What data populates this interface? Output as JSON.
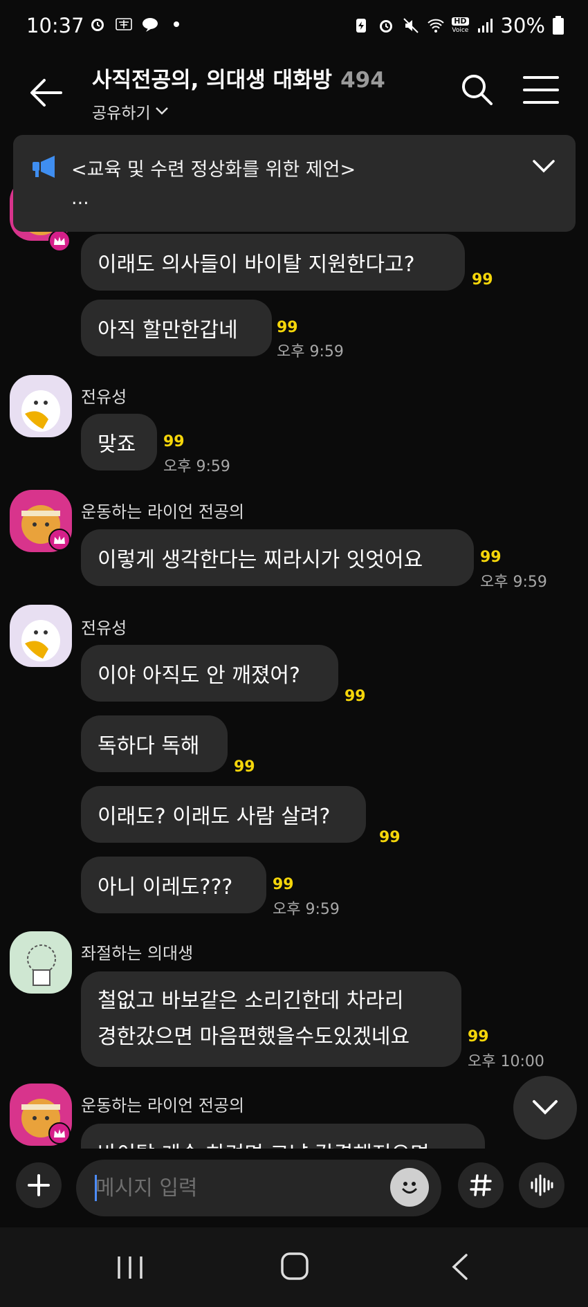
{
  "status_bar": {
    "time": "10:37",
    "left_icons": [
      "alarm-clock-icon",
      "hanja-icon",
      "cloud-chat-icon",
      "dot-icon"
    ],
    "right_icons": [
      "battery-saver-icon",
      "alarm-icon",
      "mute-icon",
      "wifi-6-icon",
      "hd-voice-icon",
      "signal-icon"
    ],
    "hd_voice_label": "HD",
    "voice_label": "Voice",
    "battery_percent": "30%"
  },
  "header": {
    "title": "사직전공의, 의대생 대화방",
    "member_count": "494",
    "share_label": "공유하기"
  },
  "notice": {
    "text": "<교육 및 수련 정상화를 위한 제언>",
    "more": "..."
  },
  "messages": [
    {
      "sender": "",
      "text": "이래도 의사들이 바이탈 지원한다고?",
      "unread": "99",
      "time": ""
    },
    {
      "sender": "",
      "text": "아직 할만한갑네",
      "unread": "99",
      "time": "오후 9:59"
    },
    {
      "sender": "전유성",
      "text": "맞죠",
      "unread": "99",
      "time": "오후 9:59"
    },
    {
      "sender": "운동하는 라이언 전공의",
      "text": "이렇게 생각한다는 찌라시가 잇엇어요",
      "unread": "99",
      "time": "오후 9:59"
    },
    {
      "sender": "전유성",
      "text": "이야 아직도 안 깨졌어?",
      "unread": "99",
      "time": ""
    },
    {
      "sender": "",
      "text": "독하다 독해",
      "unread": "99",
      "time": ""
    },
    {
      "sender": "",
      "text": "이래도? 이래도 사람 살려?",
      "unread": "99",
      "time": ""
    },
    {
      "sender": "",
      "text": "아니 이레도???",
      "unread": "99",
      "time": "오후 9:59"
    },
    {
      "sender": "좌절하는 의대생",
      "text_line1": "철없고 바보같은 소리긴한데 차라리",
      "text_line2": "경한갔으면 마음편했을수도있겠네요",
      "unread": "99",
      "time": "오후 10:00"
    },
    {
      "sender": "운동하는 라이언 전공의",
      "text": "바이탈 계속 하려면 그냥 각결해져으면",
      "unread": "",
      "time": ""
    }
  ],
  "input": {
    "placeholder": "메시지 입력"
  },
  "colors": {
    "background": "#0b0b0b",
    "bubble": "#2b2b2b",
    "unread": "#f5d60a",
    "crown_badge": "#d61f8a",
    "notice_bg": "#2a2a2a"
  },
  "icons": {
    "back": "arrow-left-icon",
    "search": "search-icon",
    "menu": "hamburger-menu-icon",
    "notice": "megaphone-icon",
    "expand": "chevron-down-icon",
    "plus": "plus-icon",
    "emoji": "smiley-icon",
    "hash": "hash-icon",
    "voice": "voice-wave-icon"
  }
}
